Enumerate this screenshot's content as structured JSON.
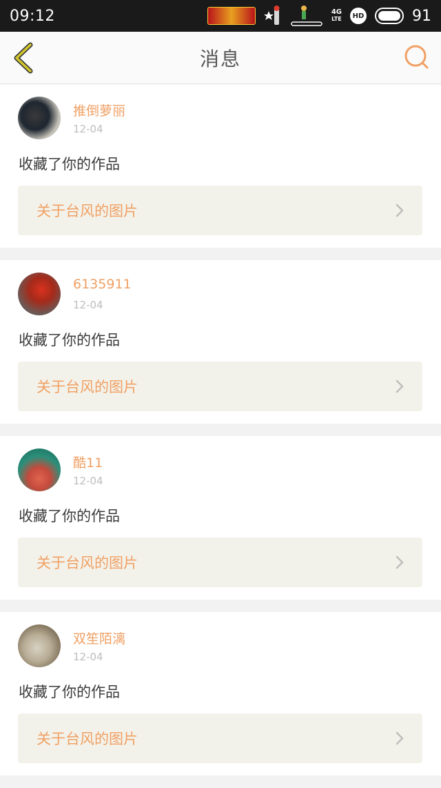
{
  "status_bar": {
    "time": "09:12",
    "network": "4G",
    "network_sub": "LTE",
    "hd": "HD",
    "battery": "91",
    "icons": [
      "game-banner-icon",
      "character-icon",
      "figure-icon",
      "signal-icon",
      "hd-icon",
      "battery-icon"
    ]
  },
  "nav": {
    "title": "消息",
    "back_icon": "chevron-left-icon",
    "search_icon": "search-icon"
  },
  "colors": {
    "accent": "#f0a064",
    "back_chevron": "#d4c82a",
    "search_ring": "#f0a064",
    "link_bg": "#f3f2ea"
  },
  "messages": [
    {
      "username": "推倒萝丽",
      "date": "12-04",
      "action": "收藏了你的作品",
      "link": "关于台风的图片"
    },
    {
      "username": "6135911",
      "date": "12-04",
      "action": "收藏了你的作品",
      "link": "关于台风的图片"
    },
    {
      "username": "酷11",
      "date": "12-04",
      "action": "收藏了你的作品",
      "link": "关于台风的图片"
    },
    {
      "username": "双笙陌漓",
      "date": "12-04",
      "action": "收藏了你的作品",
      "link": "关于台风的图片"
    }
  ]
}
